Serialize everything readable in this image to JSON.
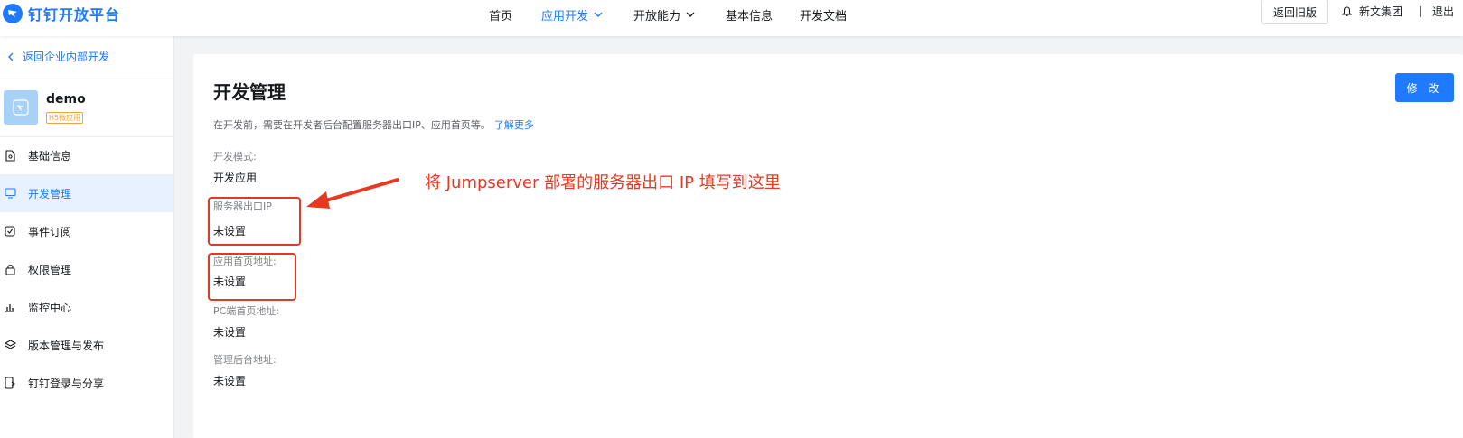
{
  "topbar": {
    "logo_text": "钉钉开放平台",
    "nav": [
      {
        "label": "首页",
        "active": false,
        "dropdown": false
      },
      {
        "label": "应用开发",
        "active": true,
        "dropdown": true
      },
      {
        "label": "开放能力",
        "active": false,
        "dropdown": true
      },
      {
        "label": "基本信息",
        "active": false,
        "dropdown": false
      },
      {
        "label": "开发文档",
        "active": false,
        "dropdown": false
      }
    ],
    "old_version_button": "返回旧版",
    "org_name": "新文集团",
    "logout": "退出"
  },
  "sidebar": {
    "back_link": "返回企业内部开发",
    "app": {
      "name": "demo",
      "tag": "H5微应用"
    },
    "menu": [
      {
        "label": "基础信息",
        "icon": "document-icon",
        "active": false
      },
      {
        "label": "开发管理",
        "icon": "monitor-icon",
        "active": true
      },
      {
        "label": "事件订阅",
        "icon": "subscribe-icon",
        "active": false
      },
      {
        "label": "权限管理",
        "icon": "lock-icon",
        "active": false
      },
      {
        "label": "监控中心",
        "icon": "bar-chart-icon",
        "active": false
      },
      {
        "label": "版本管理与发布",
        "icon": "layers-icon",
        "active": false
      },
      {
        "label": "钉钉登录与分享",
        "icon": "phone-share-icon",
        "active": false
      }
    ]
  },
  "main": {
    "title": "开发管理",
    "description": "在开发前，需要在开发者后台配置服务器出口IP、应用首页等。",
    "learn_more": "了解更多",
    "edit_button": "修 改",
    "fields": [
      {
        "label": "开发模式:",
        "value": "开发应用"
      },
      {
        "label": "服务器出口IP",
        "value": "未设置"
      },
      {
        "label": "应用首页地址:",
        "value": "未设置"
      },
      {
        "label": "PC端首页地址:",
        "value": "未设置"
      },
      {
        "label": "管理后台地址:",
        "value": "未设置"
      }
    ]
  },
  "annotation": {
    "text": "将 Jumpserver 部署的服务器出口 IP 填写到这里",
    "color": "#e8381f"
  },
  "colors": {
    "accent": "#1f7aff",
    "highlight_box": "#dc3b26",
    "active_menu_bg": "#e8f1ff"
  }
}
